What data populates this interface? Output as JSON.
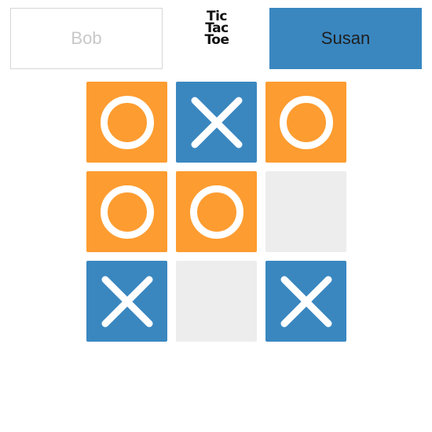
{
  "players": {
    "left": {
      "name": "Bob",
      "active": false
    },
    "right": {
      "name": "Susan",
      "active": true
    }
  },
  "logo": {
    "lines": [
      "Tic",
      "Tac",
      "Toe"
    ]
  },
  "board": {
    "cells": [
      {
        "row": 1,
        "col": 1,
        "mark": "O"
      },
      {
        "row": 1,
        "col": 2,
        "mark": "X"
      },
      {
        "row": 1,
        "col": 3,
        "mark": "O"
      },
      {
        "row": 2,
        "col": 1,
        "mark": "O"
      },
      {
        "row": 2,
        "col": 2,
        "mark": "O"
      },
      {
        "row": 2,
        "col": 3,
        "mark": ""
      },
      {
        "row": 3,
        "col": 1,
        "mark": "X"
      },
      {
        "row": 3,
        "col": 2,
        "mark": ""
      },
      {
        "row": 3,
        "col": 3,
        "mark": "X"
      }
    ]
  },
  "colors": {
    "o_tile": "#fd9c30",
    "x_tile": "#3a87c0",
    "empty_tile": "#ededed",
    "mark": "#ffffff",
    "active_player_bg": "#3a87c0"
  },
  "icons": {
    "o": "circle-o-icon",
    "x": "cross-x-icon"
  }
}
